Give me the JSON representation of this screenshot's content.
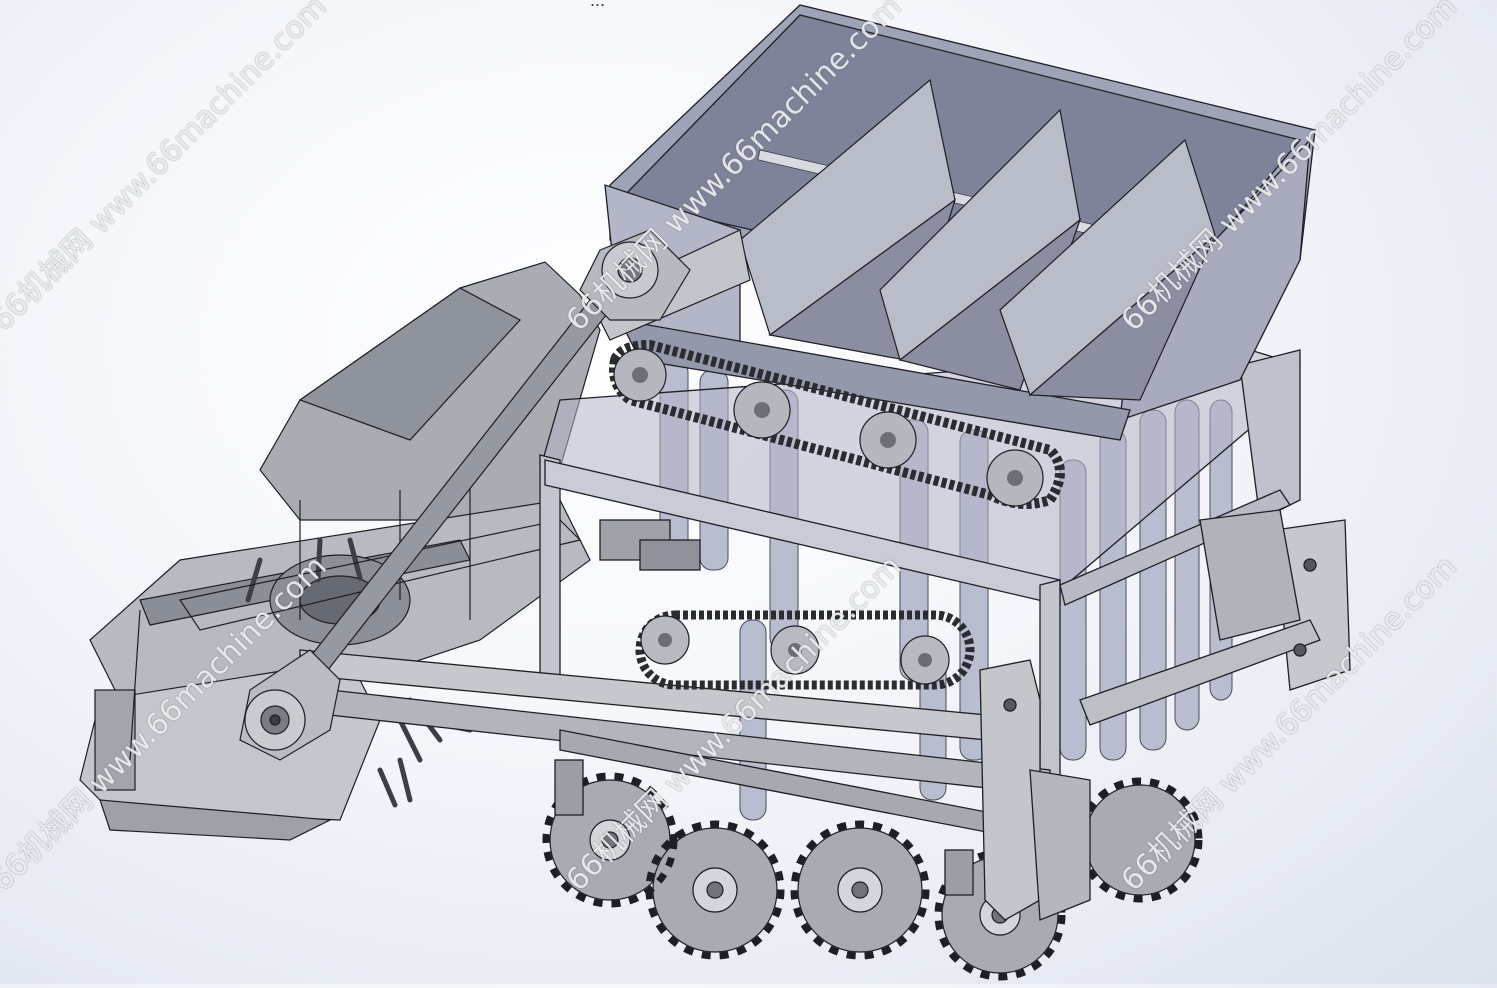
{
  "caption": "...",
  "watermark_text": "66机械网 www.66machine.com",
  "colors": {
    "metal_light": "#c9cbd0",
    "metal_mid": "#a3a6ad",
    "metal_dark": "#6e7179",
    "hopper_inner": "#7d8296",
    "edge": "#1d1f24"
  },
  "parts": [
    "seed-hopper",
    "hopper-partition-plates",
    "upper-chain-drive",
    "lower-chain-drive",
    "main-frame",
    "rotary-tiller",
    "drive-shaft",
    "seed-tubes",
    "ground-wheels"
  ]
}
